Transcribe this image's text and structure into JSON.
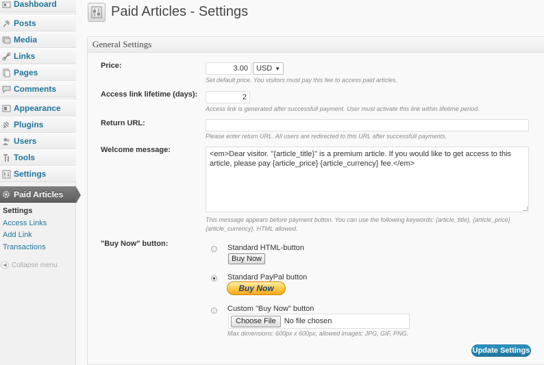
{
  "sidebar": {
    "items": [
      {
        "label": "Dashboard",
        "icon": "dashboard-icon"
      },
      {
        "label": "Posts",
        "icon": "pin-icon"
      },
      {
        "label": "Media",
        "icon": "media-icon"
      },
      {
        "label": "Links",
        "icon": "link-icon"
      },
      {
        "label": "Pages",
        "icon": "pages-icon"
      },
      {
        "label": "Comments",
        "icon": "comments-icon"
      },
      {
        "label": "Appearance",
        "icon": "appearance-icon"
      },
      {
        "label": "Plugins",
        "icon": "plugins-icon"
      },
      {
        "label": "Users",
        "icon": "users-icon"
      },
      {
        "label": "Tools",
        "icon": "tools-icon"
      },
      {
        "label": "Settings",
        "icon": "settings-icon"
      },
      {
        "label": "Paid Articles",
        "icon": "gear-icon"
      }
    ],
    "submenu": [
      "Settings",
      "Access Links",
      "Add Link",
      "Transactions"
    ],
    "collapse_label": "Collapse menu"
  },
  "header": {
    "title": "Paid Articles - Settings"
  },
  "panel": {
    "title": "General Settings",
    "price": {
      "label": "Price:",
      "value": "3.00",
      "currency": "USD",
      "description": "Set default price. You visitors must pay this fee to access paid articles."
    },
    "lifetime": {
      "label": "Access link lifetime (days):",
      "value": "2",
      "description": "Access link is generated after successfull payment. User must activate this link within lifetime period."
    },
    "return_url": {
      "label": "Return URL:",
      "value": "",
      "description": "Please enter return URL. All users are redirected to this URL after successfull payments."
    },
    "welcome": {
      "label": "Welcome message:",
      "value": "<em>Dear visitor. \"{article_title}\" is a premium article. If you would like to get access to this article, please pay {article_price} {article_currency} fee.</em>",
      "description_line1": "This message appears before payment button. You can use the following keywords: {article_title}, {article_price}",
      "description_line2": "{article_currency}. HTML allowed."
    },
    "buy_now": {
      "label": "\"Buy Now\" button:",
      "options": [
        {
          "label": "Standard HTML-button",
          "checked": false
        },
        {
          "label": "Standard PayPal button",
          "checked": true
        },
        {
          "label": "Custom \"Buy Now\" button",
          "checked": false
        }
      ],
      "html_button_label": "Buy Now",
      "paypal_button_label": "Buy Now",
      "choose_file_label": "Choose File",
      "file_status": "No file chosen",
      "dimensions_note": "Max dimensions: 600px x 600px, allowed images: JPG, GIF, PNG."
    },
    "submit_label": "Update Settings"
  },
  "colors": {
    "accent": "#21759b",
    "active_menu": "#6d6d6d",
    "paypal": "#ffc33a"
  }
}
